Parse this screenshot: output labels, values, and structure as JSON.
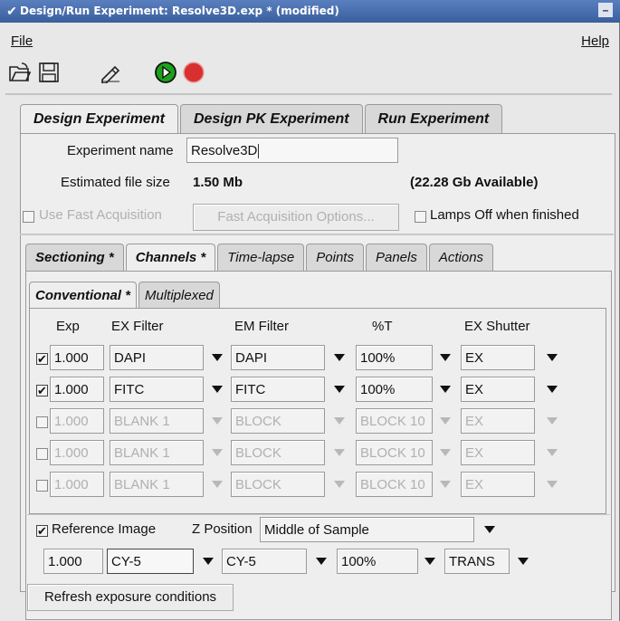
{
  "window": {
    "title": "Design/Run Experiment: Resolve3D.exp * (modified)"
  },
  "menu": {
    "file": "File",
    "help": "Help"
  },
  "main_tabs": [
    {
      "label": "Design Experiment",
      "active": true
    },
    {
      "label": "Design PK Experiment",
      "active": false
    },
    {
      "label": "Run Experiment",
      "active": false
    }
  ],
  "experiment": {
    "name_label": "Experiment name",
    "name_value": "Resolve3D",
    "size_label": "Estimated file size",
    "size_value": "1.50 Mb",
    "available": "(22.28 Gb Available)",
    "fast_acq_label": "Use Fast Acquisition",
    "fast_acq_options": "Fast Acquisition Options...",
    "lamps_off_label": "Lamps Off when finished"
  },
  "sub_tabs": [
    {
      "label": "Sectioning *",
      "active": false,
      "bold": true
    },
    {
      "label": "Channels *",
      "active": true,
      "bold": true
    },
    {
      "label": "Time-lapse",
      "active": false,
      "bold": false
    },
    {
      "label": "Points",
      "active": false,
      "bold": false
    },
    {
      "label": "Panels",
      "active": false,
      "bold": false
    },
    {
      "label": "Actions",
      "active": false,
      "bold": false
    }
  ],
  "mode_tabs": [
    {
      "label": "Conventional *",
      "active": true
    },
    {
      "label": "Multiplexed",
      "active": false
    }
  ],
  "columns": {
    "exp": "Exp",
    "ex_filter": "EX Filter",
    "em_filter": "EM Filter",
    "pct_t": "%T",
    "ex_shutter": "EX Shutter"
  },
  "rows": [
    {
      "checked": true,
      "enabled": true,
      "exp": "1.000",
      "ex": "DAPI",
      "em": "DAPI",
      "t": "100%",
      "shutter": "EX"
    },
    {
      "checked": true,
      "enabled": true,
      "exp": "1.000",
      "ex": "FITC",
      "em": "FITC",
      "t": "100%",
      "shutter": "EX"
    },
    {
      "checked": false,
      "enabled": false,
      "exp": "1.000",
      "ex": "BLANK 1",
      "em": "BLOCK",
      "t": "BLOCK 10",
      "shutter": "EX"
    },
    {
      "checked": false,
      "enabled": false,
      "exp": "1.000",
      "ex": "BLANK 1",
      "em": "BLOCK",
      "t": "BLOCK 10",
      "shutter": "EX"
    },
    {
      "checked": false,
      "enabled": false,
      "exp": "1.000",
      "ex": "BLANK 1",
      "em": "BLOCK",
      "t": "BLOCK 10",
      "shutter": "EX"
    }
  ],
  "reference": {
    "label": "Reference Image",
    "checked": true,
    "z_label": "Z Position",
    "z_value": "Middle of Sample",
    "exp": "1.000",
    "ex": "CY-5",
    "em": "CY-5",
    "t": "100%",
    "shutter": "TRANS"
  },
  "refresh_label": "Refresh exposure conditions",
  "icons": {
    "open": "open-folder-icon",
    "save": "save-disk-icon",
    "edit": "edit-pencil-icon",
    "run": "run-play-icon",
    "stop": "stop-icon"
  },
  "colors": {
    "titlebar": "#3f66a8",
    "run_green": "#1aa31a",
    "stop_red": "#d83030"
  }
}
